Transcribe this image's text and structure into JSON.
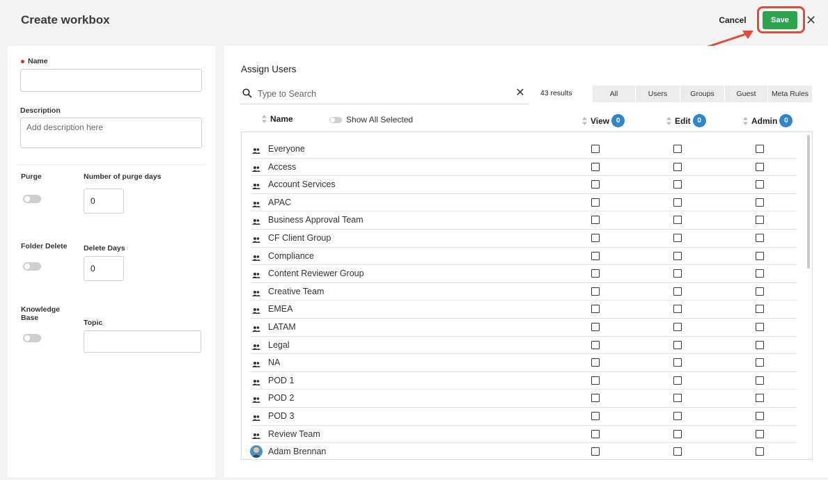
{
  "header": {
    "title": "Create workbox",
    "cancel_label": "Cancel",
    "save_label": "Save",
    "close_glyph": "✕"
  },
  "form": {
    "name_label": "Name",
    "name_value": "",
    "description_label": "Description",
    "description_placeholder": "Add description here",
    "purge_label": "Purge",
    "purge_days_label": "Number of purge days",
    "purge_days_value": "0",
    "folder_delete_label": "Folder Delete",
    "delete_days_label": "Delete Days",
    "delete_days_value": "0",
    "knowledge_base_label": "Knowledge Base",
    "topic_label": "Topic",
    "topic_value": ""
  },
  "assign": {
    "title": "Assign Users",
    "search_placeholder": "Type to Search",
    "clear_glyph": "✕",
    "results": "43 results",
    "filters": [
      "All",
      "Users",
      "Groups",
      "Guest",
      "Meta Rules"
    ],
    "show_all_label": "Show All Selected",
    "columns": {
      "name": "Name",
      "view": "View",
      "edit": "Edit",
      "admin": "Admin"
    },
    "counts": {
      "view": "0",
      "edit": "0",
      "admin": "0"
    },
    "rows": [
      {
        "label": "Everyone",
        "type": "group"
      },
      {
        "label": "Access",
        "type": "group"
      },
      {
        "label": "Account Services",
        "type": "group"
      },
      {
        "label": "APAC",
        "type": "group"
      },
      {
        "label": "Business Approval Team",
        "type": "group"
      },
      {
        "label": "CF Client Group",
        "type": "group"
      },
      {
        "label": "Compliance",
        "type": "group"
      },
      {
        "label": "Content Reviewer Group",
        "type": "group"
      },
      {
        "label": "Creative Team",
        "type": "group"
      },
      {
        "label": "EMEA",
        "type": "group"
      },
      {
        "label": "LATAM",
        "type": "group"
      },
      {
        "label": "Legal",
        "type": "group"
      },
      {
        "label": "NA",
        "type": "group"
      },
      {
        "label": "POD 1",
        "type": "group"
      },
      {
        "label": "POD 2",
        "type": "group"
      },
      {
        "label": "POD 3",
        "type": "group"
      },
      {
        "label": "Review Team",
        "type": "group"
      },
      {
        "label": "Adam Brennan",
        "type": "user"
      }
    ]
  },
  "colors": {
    "save": "#2ea44f",
    "badge": "#2f86c8",
    "highlight": "#e04a3a"
  }
}
